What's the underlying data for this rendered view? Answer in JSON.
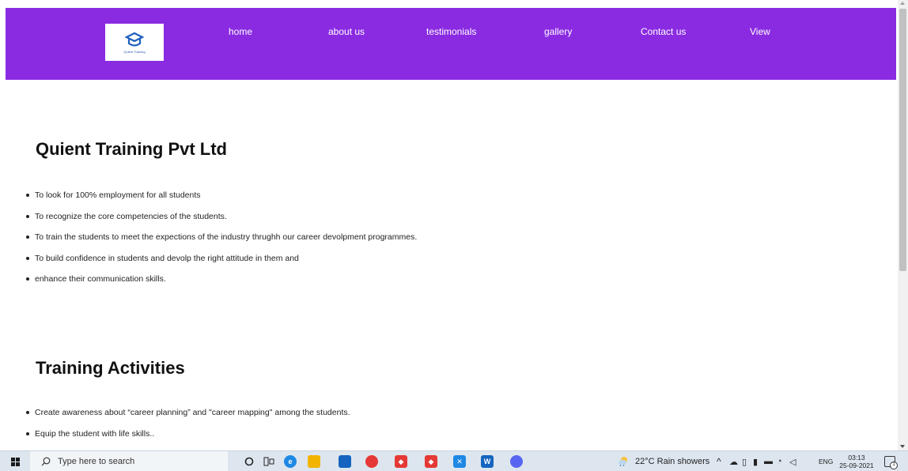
{
  "nav": {
    "logo_text": "Quient Training",
    "links": [
      "home",
      "about us",
      "testimonials",
      "gallery",
      "Contact us",
      "View"
    ]
  },
  "section1": {
    "title": "Quient Training Pvt Ltd",
    "items": [
      "To look for 100% employment for all students",
      "To recognize the core competencies of the students.",
      "To train the students to meet the expections of the industry thrughh our career devolpment programmes.",
      "To build confidence in students and devolp the right attitude in them and",
      "enhance their communication skills."
    ]
  },
  "section2": {
    "title": "Training Activities",
    "items": [
      "Create awareness about “career planning” and \"career mapping\" among the students.",
      "Equip the student with life skills.."
    ]
  },
  "taskbar": {
    "search_placeholder": "Type here to search",
    "weather": "22°C  Rain showers",
    "language": "ENG",
    "time": "03:13",
    "date": "25-09-2021"
  },
  "colors": {
    "navbar": "#8a2be2",
    "taskbar": "#dde6ef"
  }
}
